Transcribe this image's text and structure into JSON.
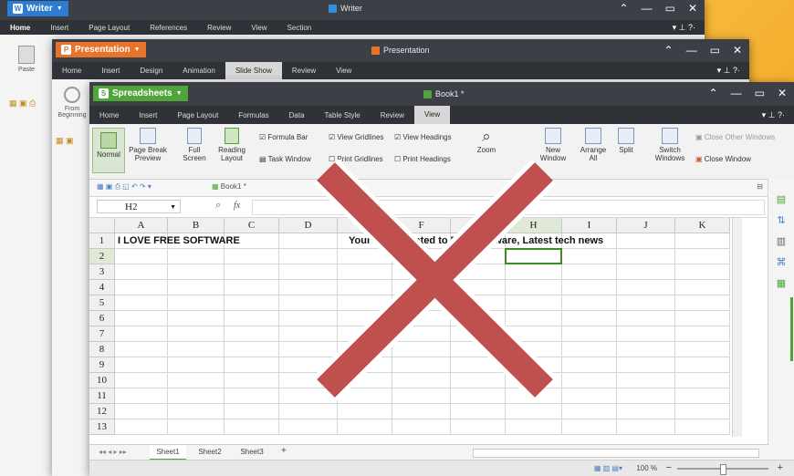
{
  "writer": {
    "app_name": "Writer",
    "title": "Writer",
    "menu": [
      "Home",
      "Insert",
      "Page Layout",
      "References",
      "Review",
      "View",
      "Section"
    ],
    "side_label": "Paste"
  },
  "presentation": {
    "app_name": "Presentation",
    "title": "Presentation",
    "menu": [
      "Home",
      "Insert",
      "Design",
      "Animation",
      "Slide Show",
      "Review",
      "View"
    ],
    "active_menu": "Slide Show",
    "side_label": "From Beginning"
  },
  "spreadsheet": {
    "app_name": "Spreadsheets",
    "title": "Book1 *",
    "menu": [
      "Home",
      "Insert",
      "Page Layout",
      "Formulas",
      "Data",
      "Table Style",
      "Review",
      "View"
    ],
    "active_menu": "View",
    "ribbon": {
      "normal": "Normal",
      "page_break_preview": "Page Break Preview",
      "full_screen": "Full Screen",
      "reading_layout": "Reading Layout",
      "formula_bar": "Formula Bar",
      "view_gridlines": "View Gridlines",
      "view_headings": "View Headings",
      "task_window": "Task Window",
      "print_gridlines": "Print Gridlines",
      "print_headings": "Print Headings",
      "zoom": "Zoom",
      "new_window": "New Window",
      "arrange_all": "Arrange All",
      "split": "Split",
      "switch_windows": "Switch Windows",
      "close_other_windows": "Close Other Windows",
      "close_window": "Close Window"
    },
    "doc_tab": "Book1 *",
    "name_box": "H2",
    "fx": "fx",
    "columns": [
      "A",
      "B",
      "C",
      "D",
      "E",
      "F",
      "G",
      "H",
      "I",
      "J",
      "K"
    ],
    "rows": [
      "1",
      "2",
      "3",
      "4",
      "5",
      "6",
      "7",
      "8",
      "9",
      "10",
      "11",
      "12",
      "13"
    ],
    "cell_a1": "I LOVE FREE SOFTWARE",
    "cell_e1": "Your ... ing related to Free Software, Latest tech news",
    "sheet_tabs": [
      "Sheet1",
      "Sheet2",
      "Sheet3"
    ],
    "add_sheet": "+",
    "zoom_level": "100 %"
  },
  "overlay": {
    "symbol": "cross",
    "color": "#c0504d"
  },
  "colors": {
    "writer": "#2b7cd3",
    "presentation": "#e8742a",
    "spreadsheet": "#4fa43a",
    "titlebar": "#3c3f45"
  }
}
